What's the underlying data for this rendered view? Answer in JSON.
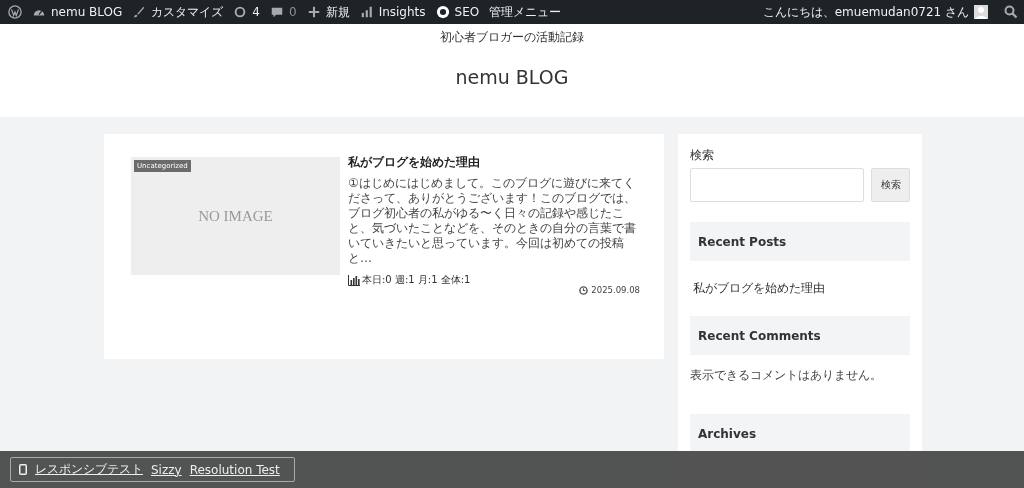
{
  "admin_bar": {
    "items": [
      {
        "kind": "wp"
      },
      {
        "kind": "site",
        "label": "nemu BLOG"
      },
      {
        "kind": "brush",
        "label": "カスタマイズ"
      },
      {
        "kind": "update",
        "label": "4"
      },
      {
        "kind": "comment",
        "label": "0"
      },
      {
        "kind": "plus",
        "label": "新規"
      },
      {
        "kind": "chart",
        "label": "Insights"
      },
      {
        "kind": "seo",
        "label": "SEO"
      },
      {
        "kind": "none",
        "label": "管理メニュー"
      }
    ],
    "greeting": "こんにちは、emuemudan0721 さん"
  },
  "header": {
    "tagline": "初心者ブロガーの活動記録",
    "title": "nemu BLOG"
  },
  "post": {
    "category": "Uncategorized",
    "thumbnail": "NO IMAGE",
    "title": "私がブログを始めた理由",
    "excerpt": "①はじめにはじめまして。このブログに遊びに来てくださって、ありがとうございます！このブログでは、ブログ初心者の私がゆる〜く日々の記録や感じたこと、気づいたことなどを、そのときの自分の言葉で書いていきたいと思っています。今回は初めての投稿と…",
    "views": "本日:0 週:1 月:1 全体:1",
    "date": "2025.09.08"
  },
  "sidebar": {
    "search_label": "検索",
    "search_button": "検索",
    "recent_posts_title": "Recent Posts",
    "recent_posts": [
      "私がブログを始めた理由"
    ],
    "recent_comments_title": "Recent Comments",
    "no_comments": "表示できるコメントはありません。",
    "archives_title": "Archives"
  },
  "bottom_bar": {
    "links": [
      "レスポンシブテスト",
      "Sizzy",
      "Resolution Test"
    ]
  }
}
